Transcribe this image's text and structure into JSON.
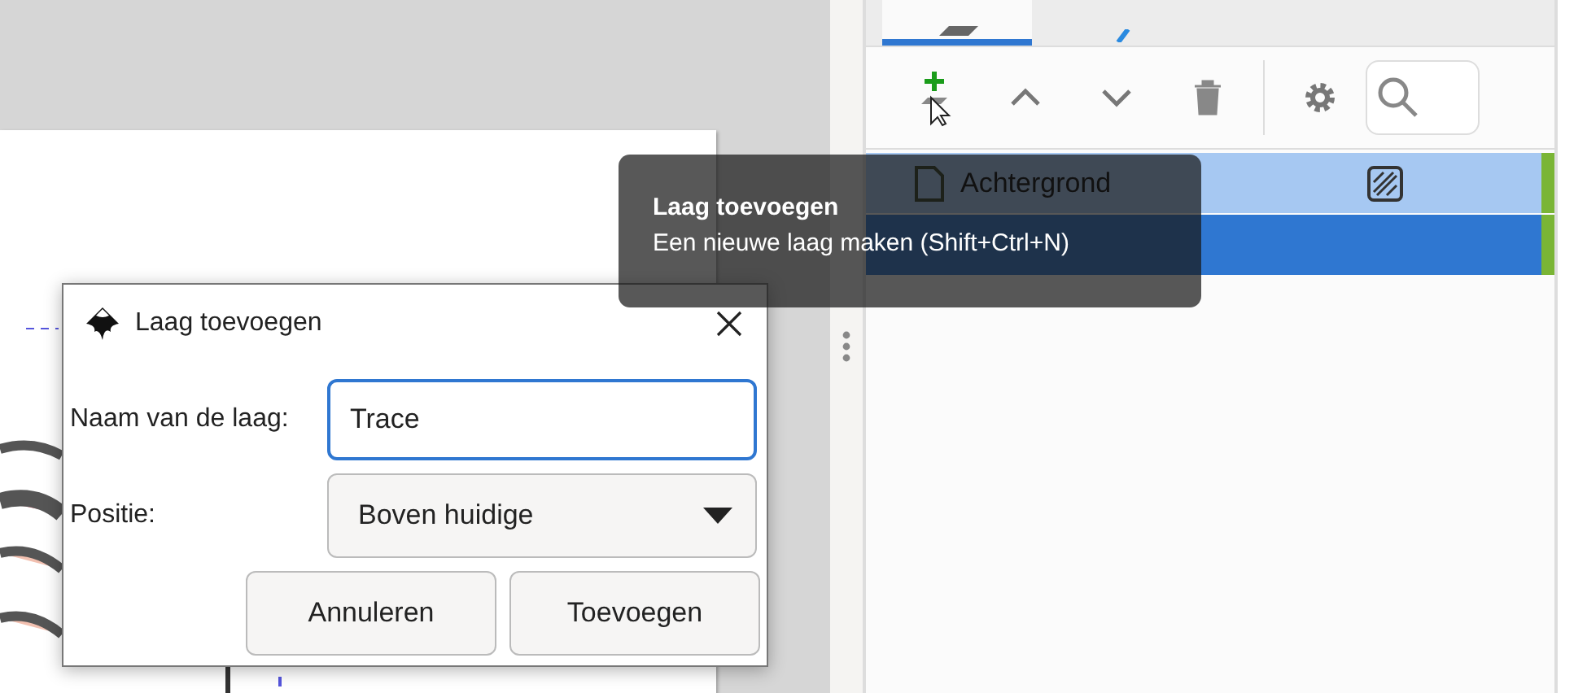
{
  "panel_tabs": [
    {
      "selected": true
    },
    {
      "selected": false
    }
  ],
  "layers": [
    {
      "name": "Achtergrond",
      "selected": false,
      "hovered": true,
      "locked_pattern": true,
      "color": "#7ab535"
    },
    {
      "selected": true,
      "locked_pattern": false,
      "color": "#7ab535"
    }
  ],
  "tooltip": {
    "title": "Laag toevoegen",
    "text": "Een nieuwe laag maken (Shift+Ctrl+N)"
  },
  "dialog": {
    "title": "Laag toevoegen",
    "name_label": "Naam van de laag:",
    "name_value": "Trace",
    "position_label": "Positie:",
    "position_value": "Boven huidige",
    "buttons": [
      {
        "label": "Annuleren",
        "default": false
      },
      {
        "label": "Toevoegen",
        "default": false
      }
    ]
  }
}
